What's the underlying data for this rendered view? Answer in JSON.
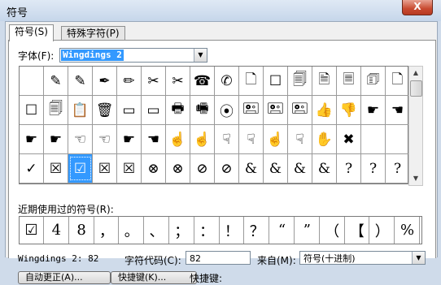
{
  "window": {
    "title": "符号",
    "close_label": "X"
  },
  "tabs": [
    {
      "label": "符号(S)"
    },
    {
      "label": "特殊字符(P)"
    }
  ],
  "font": {
    "label": "字体(F):",
    "value": "Wingdings 2"
  },
  "symbol_grid": {
    "rows": [
      [
        "",
        "✎",
        "✎",
        "✒",
        "✏",
        "✂",
        "✂",
        "☎",
        "✆",
        "🗋",
        "☐",
        "🗐",
        "🗎",
        "🗏",
        "🗊",
        "🗋"
      ],
      [
        "☐",
        "🗐",
        "📋",
        "🗑",
        "▭",
        "▭",
        "🖶",
        "🖷",
        "⦿",
        "🖭",
        "🖭",
        "🖭",
        "👍",
        "👎",
        "☛",
        "☚"
      ],
      [
        "☛",
        "☛",
        "☜",
        "☜",
        "☛",
        "☚",
        "☝",
        "☝",
        "☟",
        "☟",
        "☝",
        "☟",
        "✋",
        "✖",
        "",
        ""
      ],
      [
        "✓",
        "☒",
        "☑",
        "☒",
        "☒",
        "⊗",
        "⊗",
        "⊘",
        "⊘",
        "&",
        "&",
        "&",
        "&",
        "?",
        "?",
        "?"
      ]
    ],
    "selected": {
      "row": 3,
      "col": 2
    }
  },
  "recent": {
    "label": "近期使用过的符号(R):",
    "symbols": [
      "☑",
      "4",
      "8",
      "，",
      "。",
      "、",
      "；",
      "：",
      "！",
      "？",
      "“",
      "”",
      "（",
      "【",
      "）",
      "%"
    ]
  },
  "info": {
    "char_name": "Wingdings 2: 82",
    "char_code_label": "字符代码(C):",
    "char_code_value": "82",
    "from_label": "来自(M):",
    "from_value": "符号(十进制)"
  },
  "buttons": {
    "autocorrect": "自动更正(A)...",
    "shortcut_key": "快捷键(K)...",
    "shortcut_text": "快捷键:"
  }
}
